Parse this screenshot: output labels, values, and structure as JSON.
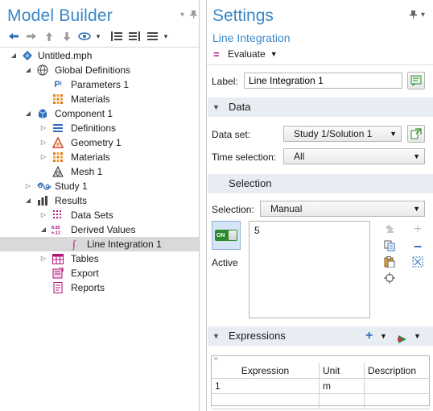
{
  "model_builder": {
    "title": "Model Builder",
    "tree": [
      {
        "label": "Untitled.mph",
        "icon": "model-root-icon"
      },
      {
        "label": "Global Definitions",
        "icon": "globe-icon"
      },
      {
        "label": "Parameters 1",
        "icon": "parameters-icon"
      },
      {
        "label": "Materials",
        "icon": "materials-icon"
      },
      {
        "label": "Component 1",
        "icon": "component-icon"
      },
      {
        "label": "Definitions",
        "icon": "definitions-icon"
      },
      {
        "label": "Geometry 1",
        "icon": "geometry-icon"
      },
      {
        "label": "Materials",
        "icon": "materials-icon"
      },
      {
        "label": "Mesh 1",
        "icon": "mesh-icon"
      },
      {
        "label": "Study 1",
        "icon": "study-icon"
      },
      {
        "label": "Results",
        "icon": "results-icon"
      },
      {
        "label": "Data Sets",
        "icon": "datasets-icon"
      },
      {
        "label": "Derived Values",
        "icon": "derived-values-icon"
      },
      {
        "label": "Line Integration 1",
        "icon": "integral-icon"
      },
      {
        "label": "Tables",
        "icon": "table-icon"
      },
      {
        "label": "Export",
        "icon": "export-icon"
      },
      {
        "label": "Reports",
        "icon": "report-icon"
      }
    ],
    "selected_item": "Line Integration 1"
  },
  "settings": {
    "title": "Settings",
    "subtitle": "Line Integration",
    "evaluate_label": "Evaluate",
    "label_field": {
      "label": "Label:",
      "value": "Line Integration 1"
    },
    "data_section": {
      "header": "Data",
      "data_set": {
        "label": "Data set:",
        "value": "Study 1/Solution 1"
      },
      "time_selection": {
        "label": "Time selection:",
        "value": "All"
      }
    },
    "selection_section": {
      "header": "Selection",
      "selection": {
        "label": "Selection:",
        "value": "Manual"
      },
      "toggle_text": "ON",
      "active_label": "Active",
      "selection_list": [
        "5"
      ]
    },
    "expressions_section": {
      "header": "Expressions",
      "columns": [
        "Expression",
        "Unit",
        "Description"
      ],
      "rows": [
        {
          "expression": "1",
          "unit": "m",
          "description": ""
        }
      ]
    }
  },
  "colors": {
    "title_blue": "#3a87c8",
    "section_bg": "#e8edf3",
    "selected_row_bg": "#d9d9d9",
    "toggle_on_green": "#2b8a2b"
  }
}
